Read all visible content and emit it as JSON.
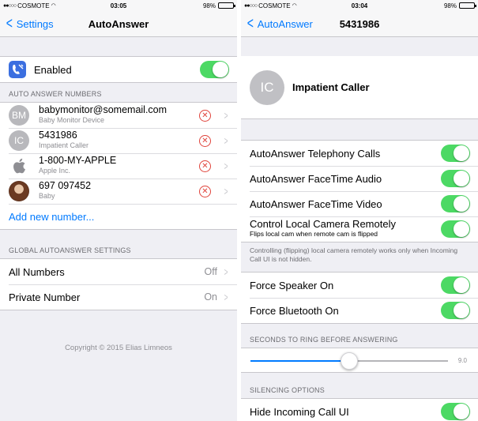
{
  "left": {
    "status": {
      "carrier": "COSMOTE",
      "time": "03:05",
      "battery": "98%"
    },
    "nav": {
      "back_label": "Settings",
      "title": "AutoAnswer"
    },
    "enabled": {
      "label": "Enabled",
      "on": true
    },
    "numbers_header": "AUTO ANSWER NUMBERS",
    "numbers": [
      {
        "avatar": "BM",
        "main": "babymonitor@somemail.com",
        "sub": "Baby Monitor Device",
        "avatar_type": "initials"
      },
      {
        "avatar": "IC",
        "main": "5431986",
        "sub": "Impatient Caller",
        "avatar_type": "initials"
      },
      {
        "avatar": "",
        "main": "1-800-MY-APPLE",
        "sub": "Apple Inc.",
        "avatar_type": "apple-logo"
      },
      {
        "avatar": "",
        "main": "697 097452",
        "sub": "Baby",
        "avatar_type": "photo"
      }
    ],
    "add_new_label": "Add new number...",
    "global_header": "GLOBAL AUTOANSWER SETTINGS",
    "global_rows": [
      {
        "label": "All Numbers",
        "value": "Off"
      },
      {
        "label": "Private Number",
        "value": "On"
      }
    ],
    "copyright": "Copyright © 2015 Elias Limneos"
  },
  "right": {
    "status": {
      "carrier": "COSMOTE",
      "time": "03:04",
      "battery": "98%"
    },
    "nav": {
      "back_label": "AutoAnswer",
      "title": "5431986"
    },
    "caller": {
      "avatar": "IC",
      "name": "Impatient Caller"
    },
    "toggles": [
      {
        "label": "AutoAnswer Telephony Calls",
        "on": true
      },
      {
        "label": "AutoAnswer FaceTime Audio",
        "on": true
      },
      {
        "label": "AutoAnswer FaceTime Video",
        "on": true
      },
      {
        "label": "Control Local Camera Remotely",
        "sub": "Flips local cam when remote cam is flipped",
        "on": true
      }
    ],
    "camera_note": "Controlling (flipping) local camera remotely works only when Incoming Call UI is not hidden.",
    "force_toggles": [
      {
        "label": "Force Speaker On",
        "on": true
      },
      {
        "label": "Force Bluetooth On",
        "on": true
      }
    ],
    "ring_header": "SECONDS TO RING BEFORE ANSWERING",
    "ring_slider": {
      "value": 9.0,
      "max": 18.0,
      "label": "9.0"
    },
    "silencing_header": "SILENCING OPTIONS",
    "silencing_toggles": [
      {
        "label": "Hide Incoming Call UI",
        "on": true
      }
    ]
  },
  "colors": {
    "accent": "#007aff",
    "toggle_on": "#4cd964",
    "delete": "#e0433b",
    "background": "#efeff4"
  }
}
